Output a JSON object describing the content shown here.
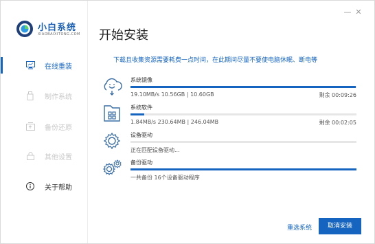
{
  "app": {
    "name": "小白系统",
    "domain": "XIAOBAIXITONG.COM",
    "brand_color": "#1565c0"
  },
  "window_controls": {
    "minimize_icon": "minimize-icon",
    "close_icon": "close-icon"
  },
  "sidebar": {
    "items": [
      {
        "label": "在线重装",
        "icon": "monitor-icon",
        "state": "active"
      },
      {
        "label": "制作系统",
        "icon": "usb-drive-icon",
        "state": "disabled"
      },
      {
        "label": "备份还原",
        "icon": "backup-icon",
        "state": "disabled"
      },
      {
        "label": "其他设置",
        "icon": "lock-icon",
        "state": "disabled"
      },
      {
        "label": "关于帮助",
        "icon": "info-icon",
        "state": "normal"
      }
    ]
  },
  "main": {
    "title": "开始安装",
    "notice": "下载且收集资源需要耗费一点时间，在此期间尽量不要使电脑休眠、断电等",
    "tasks": [
      {
        "name": "系统镜像",
        "icon": "cloud-download-icon",
        "status": "19.10MB/s 10.56GB | 10.60GB",
        "remaining": "剩余 00:09:26",
        "progress": 0.996
      },
      {
        "name": "系统软件",
        "icon": "software-package-icon",
        "status": "1.84MB/s 230.64MB | 246.04MB",
        "remaining": "剩余 00:02:05",
        "progress": 0.06
      },
      {
        "name": "设备驱动",
        "icon": "gear-icon",
        "status": "正在匹配设备驱动...",
        "remaining": "",
        "progress": 0
      },
      {
        "name": "备份驱动",
        "icon": "gears-icon",
        "status": "一共备份 16个设备驱动程序",
        "remaining": "",
        "progress": 1.0
      }
    ]
  },
  "footer": {
    "reselect_label": "重选系统",
    "cancel_label": "取消安装"
  }
}
